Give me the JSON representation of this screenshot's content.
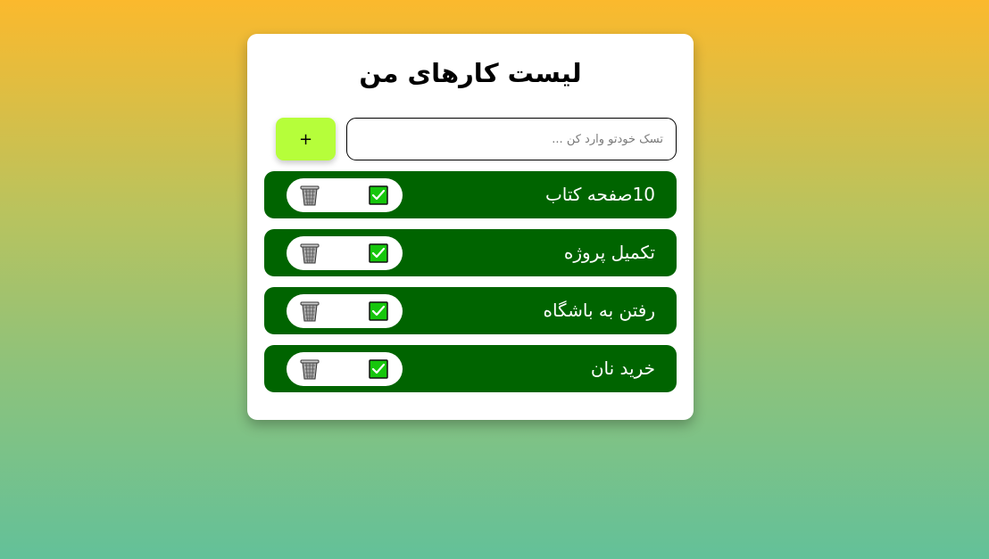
{
  "header": {
    "title": "لیست کارهای من"
  },
  "form": {
    "input_value": "",
    "input_placeholder": "تسک خودتو وارد کن ...",
    "add_label": "+"
  },
  "todos": [
    {
      "text": "10صفحه کتاب",
      "done_icon": "check-icon",
      "delete_icon": "trash-icon"
    },
    {
      "text": "تکمیل پروژه",
      "done_icon": "check-icon",
      "delete_icon": "trash-icon"
    },
    {
      "text": "رفتن به باشگاه",
      "done_icon": "check-icon",
      "delete_icon": "trash-icon"
    },
    {
      "text": "خرید نان",
      "done_icon": "check-icon",
      "delete_icon": "trash-icon"
    }
  ],
  "colors": {
    "background_top": "#fbb92d",
    "background_bottom": "#63c199",
    "card": "#ffffff",
    "item_bg": "#006400",
    "add_button": "#b6fe3a",
    "check_fill": "#16c60c"
  }
}
